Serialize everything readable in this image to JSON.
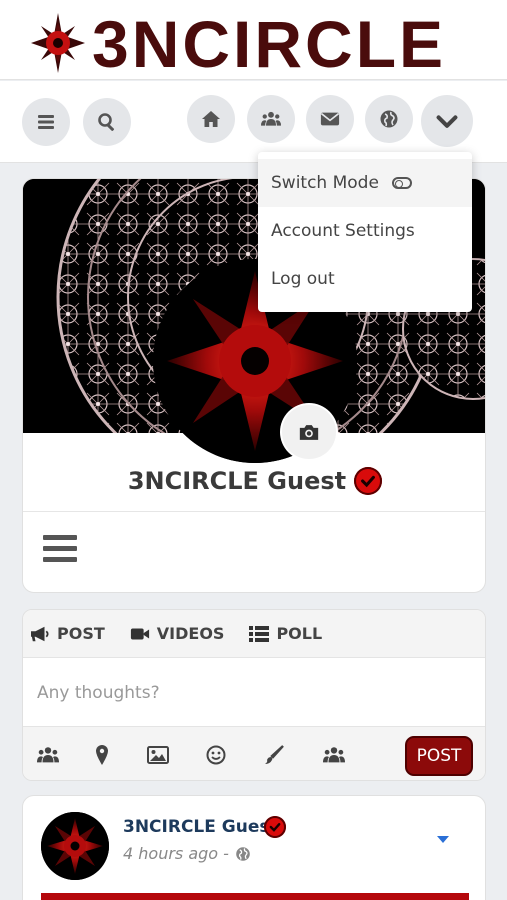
{
  "logo": {
    "text": "3NCIRCLE",
    "icon": "compass-star-logo-icon",
    "color": "#4a0c0c"
  },
  "nav": {
    "buttons": [
      {
        "name": "menu",
        "icon": "bars-icon"
      },
      {
        "name": "search",
        "icon": "search-icon"
      },
      {
        "name": "home",
        "icon": "home-icon"
      },
      {
        "name": "groups",
        "icon": "users-icon"
      },
      {
        "name": "messages",
        "icon": "envelope-icon"
      },
      {
        "name": "explore",
        "icon": "globe-icon"
      },
      {
        "name": "account-menu",
        "icon": "chevron-down-icon"
      }
    ]
  },
  "dropdown": {
    "items": [
      {
        "label": "Switch Mode",
        "icon": "toggle-icon"
      },
      {
        "label": "Account Settings"
      },
      {
        "label": "Log out"
      }
    ]
  },
  "profile": {
    "name": "3NCIRCLE Guest",
    "verified_icon": "verified-check-icon",
    "camera_icon": "camera-icon",
    "menu_icon": "hamburger-icon"
  },
  "composer": {
    "tabs": [
      {
        "label": "POST",
        "icon": "megaphone-icon"
      },
      {
        "label": "VIDEOS",
        "icon": "video-camera-icon"
      },
      {
        "label": "POLL",
        "icon": "list-icon"
      }
    ],
    "placeholder": "Any thoughts?",
    "tools": [
      "users-icon",
      "map-marker-icon",
      "image-icon",
      "smiley-icon",
      "paintbrush-icon",
      "users-icon"
    ],
    "post_label": "POST"
  },
  "feed": {
    "name": "3NCIRCLE Guest",
    "time": "4 hours ago -",
    "globe_icon": "globe-icon",
    "caret_icon": "caret-down-icon"
  },
  "colors": {
    "brand": "#8c0a0a",
    "verified": "#d90b0b",
    "link": "#1d3a5c",
    "accent_blue": "#2a6fd6"
  }
}
